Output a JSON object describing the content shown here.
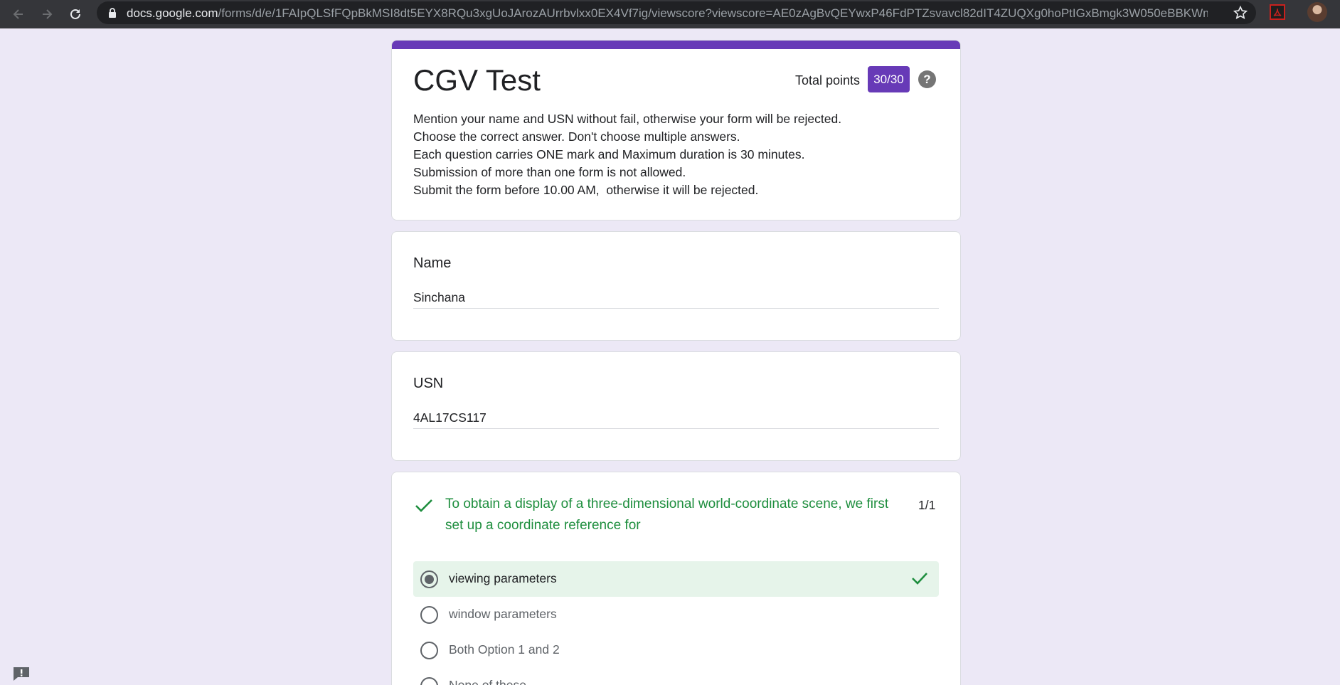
{
  "browser": {
    "url_host": "docs.google.com",
    "url_path": "/forms/d/e/1FAIpQLSfFQpBkMSI8dt5EYX8RQu3xgUoJArozAUrrbvlxx0EX4Vf7ig/viewscore?viewscore=AE0zAgBvQEYwxP46FdPTZsvavcl82dIT4ZUQXg0hoPtIGxBmgk3W050eBBKWmm...",
    "icons": [
      "back-icon",
      "forward-icon",
      "reload-icon",
      "lock-icon",
      "star-icon",
      "pdf-extension-icon",
      "profile-avatar"
    ]
  },
  "form": {
    "title": "CGV Test",
    "points_label": "Total points",
    "points_value": "30/30",
    "accent_color": "#673ab7",
    "background_color": "#ece8f6",
    "description": [
      "Mention your name and USN without fail, otherwise your form will be rejected.",
      "Choose the correct answer. Don't choose multiple answers.",
      "Each question carries ONE mark and Maximum duration is 30 minutes.",
      "Submission of more than one form is not allowed.",
      "Submit the form before 10.00 AM,  otherwise it will be rejected."
    ]
  },
  "questions": {
    "name": {
      "label": "Name",
      "answer": "Sinchana"
    },
    "usn": {
      "label": "USN",
      "answer": "4AL17CS117"
    },
    "q1": {
      "text": "To obtain a display of a three-dimensional world-coordinate scene, we first set up a coordinate reference for",
      "score": "1/1",
      "correct_color": "#1e8e3e",
      "options": [
        {
          "label": "viewing parameters",
          "selected": true,
          "correct": true
        },
        {
          "label": "window parameters",
          "selected": false
        },
        {
          "label": "Both Option 1 and 2",
          "selected": false
        },
        {
          "label": "None of these",
          "selected": false
        }
      ]
    }
  }
}
